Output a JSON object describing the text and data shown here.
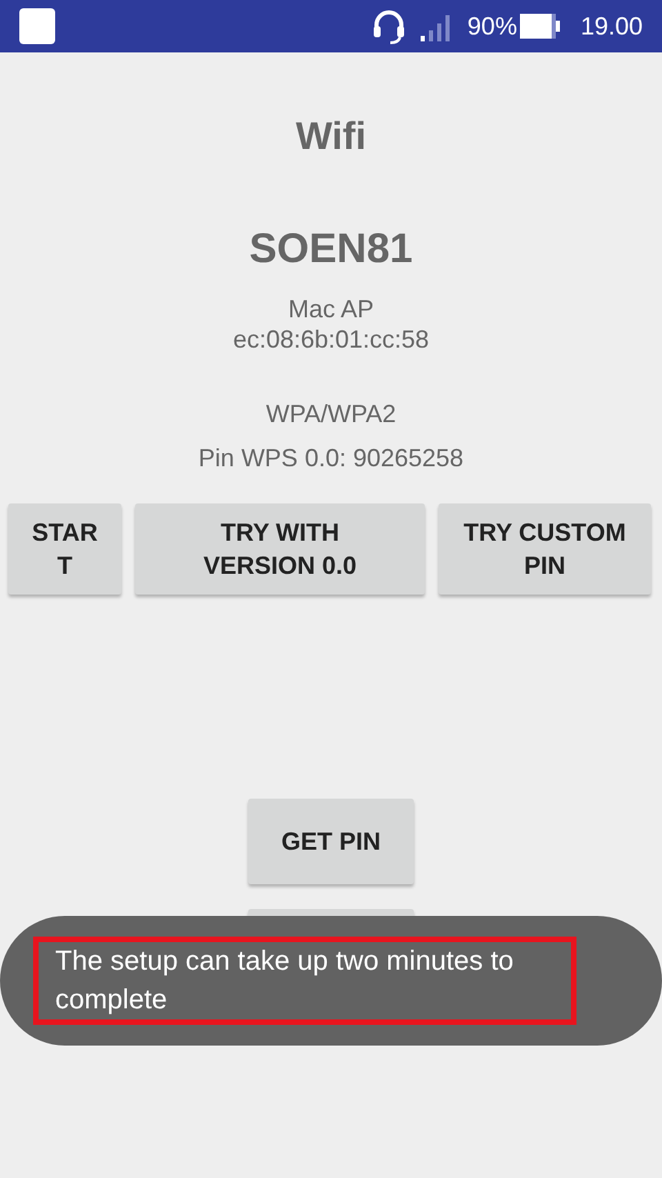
{
  "status_bar": {
    "battery_percent": "90%",
    "time": "19.00"
  },
  "title": "Wifi",
  "network": {
    "ssid": "SOEN81",
    "mac_label": "Mac AP",
    "mac": "ec:08:6b:01:cc:58",
    "security": "WPA/WPA2",
    "pin": "Pin WPS 0.0: 90265258"
  },
  "buttons": [
    "STAR T",
    "TRY WITH VERSION 0.0",
    "TRY CUSTOM PIN"
  ],
  "get_pin": "GET PIN",
  "toast": {
    "message": "The setup can take up two minutes to complete",
    "highlighted": true
  }
}
